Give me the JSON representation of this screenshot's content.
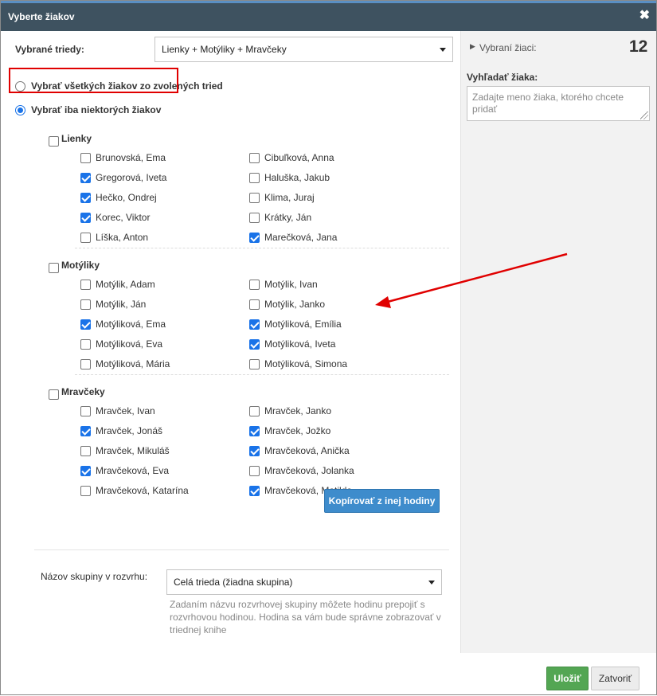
{
  "dialog": {
    "title": "Vyberte žiakov",
    "close_glyph": "✖"
  },
  "classes_selector": {
    "label": "Vybrané triedy:",
    "value": "Lienky + Motýliky + Mravčeky"
  },
  "mode": {
    "all_label": "Vybrať všetkých žiakov zo zvolených tried",
    "some_label": "Vybrať iba niektorých žiakov",
    "selected": "some"
  },
  "groups": [
    {
      "name": "Lienky",
      "checked": false,
      "students": [
        {
          "name": "Brunovská, Ema",
          "checked": false
        },
        {
          "name": "Cibuľková, Anna",
          "checked": false
        },
        {
          "name": "Gregorová, Iveta",
          "checked": true
        },
        {
          "name": "Haluška, Jakub",
          "checked": false
        },
        {
          "name": "Hečko, Ondrej",
          "checked": true
        },
        {
          "name": "Klima, Juraj",
          "checked": false
        },
        {
          "name": "Korec, Viktor",
          "checked": true
        },
        {
          "name": "Krátky, Ján",
          "checked": false
        },
        {
          "name": "Líška, Anton",
          "checked": false
        },
        {
          "name": "Marečková, Jana",
          "checked": true
        }
      ]
    },
    {
      "name": "Motýliky",
      "checked": false,
      "students": [
        {
          "name": "Motýlik, Adam",
          "checked": false
        },
        {
          "name": "Motýlik, Ivan",
          "checked": false
        },
        {
          "name": "Motýlik, Ján",
          "checked": false
        },
        {
          "name": "Motýlik, Janko",
          "checked": false
        },
        {
          "name": "Motýliková, Ema",
          "checked": true
        },
        {
          "name": "Motýliková, Emília",
          "checked": true
        },
        {
          "name": "Motýliková, Eva",
          "checked": false
        },
        {
          "name": "Motýliková, Iveta",
          "checked": true
        },
        {
          "name": "Motýliková, Mária",
          "checked": false
        },
        {
          "name": "Motýliková, Simona",
          "checked": false
        }
      ]
    },
    {
      "name": "Mravčeky",
      "checked": false,
      "students": [
        {
          "name": "Mravček, Ivan",
          "checked": false
        },
        {
          "name": "Mravček, Janko",
          "checked": false
        },
        {
          "name": "Mravček, Jonáš",
          "checked": true
        },
        {
          "name": "Mravček, Jožko",
          "checked": true
        },
        {
          "name": "Mravček, Mikuláš",
          "checked": false
        },
        {
          "name": "Mravčeková, Anička",
          "checked": true
        },
        {
          "name": "Mravčeková, Eva",
          "checked": true
        },
        {
          "name": "Mravčeková, Jolanka",
          "checked": false
        },
        {
          "name": "Mravčeková, Katarína",
          "checked": false
        },
        {
          "name": "Mravčeková, Matilda",
          "checked": true
        }
      ]
    }
  ],
  "copy_button": {
    "label": "Kopírovať z inej hodiny"
  },
  "schedule_group": {
    "label": "Názov skupiny v rozvrhu:",
    "value": "Celá trieda (žiadna skupina)",
    "hint": "Zadaním názvu rozvrhovej skupiny môžete hodinu prepojiť s rozvrhovou hodinou. Hodina sa vám bude správne zobrazovať v triednej knihe"
  },
  "right_panel": {
    "selected_label": "Vybraní žiaci:",
    "selected_count": "12",
    "search_label": "Vyhľadať žiaka:",
    "search_placeholder": "Zadajte meno žiaka, ktorého chcete pridať"
  },
  "footer": {
    "save_label": "Uložiť",
    "close_label": "Zatvoriť"
  },
  "colors": {
    "accent": "#1a73e8",
    "titlebar": "#3e5260",
    "save": "#53a653",
    "copy": "#3e8ccc",
    "annotation": "#e00000"
  }
}
